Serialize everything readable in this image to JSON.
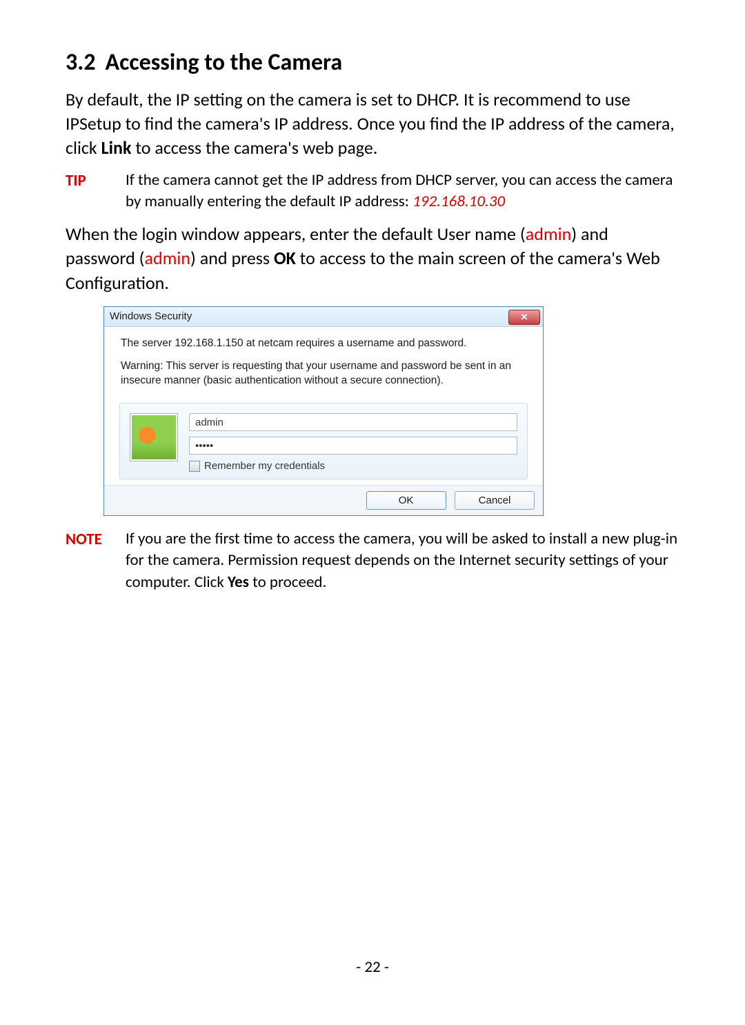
{
  "heading": {
    "number": "3.2",
    "title": "Accessing to the Camera"
  },
  "para1": {
    "pre": "By default, the IP setting on the camera is set to DHCP. It is recommend to use IPSetup to find the camera's IP address. Once you find the IP address of the camera, click ",
    "link_word": "Link",
    "post": " to access the camera's web page."
  },
  "tip": {
    "label": "TIP",
    "text": "If the camera cannot get the IP address from DHCP server, you can access the camera by manually entering the default IP address: ",
    "ip": "192.168.10.30"
  },
  "para2": {
    "p1": "When the login window appears, enter the default User name (",
    "admin1": "admin",
    "p2": ") and password (",
    "admin2": "admin",
    "p3": ") and press ",
    "ok": "OK",
    "p4": " to access to the main screen of the camera's Web Configuration."
  },
  "dialog": {
    "title": "Windows Security",
    "line1": "The server 192.168.1.150 at netcam requires a username and password.",
    "line2": "Warning: This server is requesting that your username and password be sent in an insecure manner (basic authentication without a secure connection).",
    "username": "admin",
    "password": "•••••",
    "remember": "Remember my credentials",
    "ok": "OK",
    "cancel": "Cancel"
  },
  "note": {
    "label": "NOTE",
    "p1": "If you are the first time to access the camera, you will be asked to install a new plug-in for the camera. Permission request depends on the Internet security settings of your computer. Click ",
    "yes": "Yes",
    "p2": " to proceed."
  },
  "page_number": "- 22 -"
}
